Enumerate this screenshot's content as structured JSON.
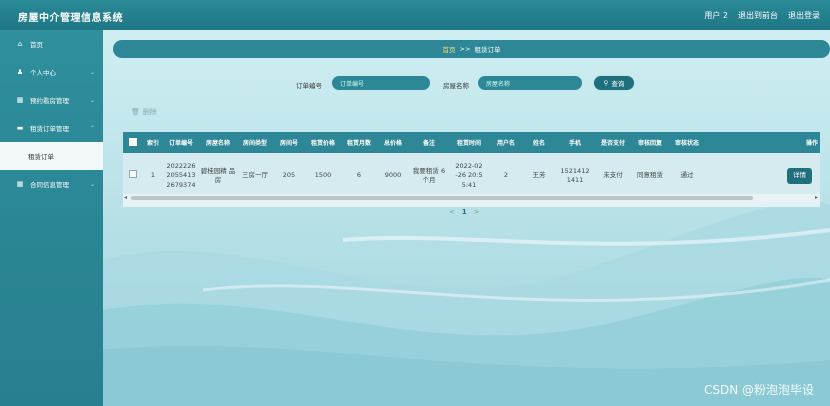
{
  "header": {
    "app_title": "房屋中介管理信息系统",
    "user": "用户 2",
    "back_to_front": "退出到前台",
    "logout": "退出登录"
  },
  "sidebar": {
    "items": [
      {
        "icon": "home-icon",
        "glyph": "⌂",
        "label": "首页",
        "has_chevron": false
      },
      {
        "icon": "user-icon",
        "glyph": "♟",
        "label": "个人中心",
        "has_chevron": true
      },
      {
        "icon": "grid-icon",
        "glyph": "▦",
        "label": "预约看房管理",
        "has_chevron": true
      },
      {
        "icon": "card-icon",
        "glyph": "▬",
        "label": "租赁订单管理",
        "has_chevron": true
      },
      {
        "icon": "",
        "glyph": "",
        "label": "租赁订单",
        "has_chevron": false,
        "active": true
      },
      {
        "icon": "grid-icon",
        "glyph": "▦",
        "label": "合同信息管理",
        "has_chevron": true
      }
    ]
  },
  "breadcrumb": {
    "home": "首页",
    "sep": ">>",
    "current": "租赁订单"
  },
  "search": {
    "order_label": "订单编号",
    "order_placeholder": "订单编号",
    "house_label": "房屋名称",
    "house_placeholder": "房屋名称",
    "search_btn": "查询"
  },
  "toolbar": {
    "delete_label": "删除"
  },
  "table": {
    "columns": [
      "索引",
      "订单编号",
      "房屋名称",
      "房间类型",
      "房间号",
      "租赁价格",
      "租赁月数",
      "总价格",
      "备注",
      "租赁时间",
      "用户名",
      "姓名",
      "手机",
      "是否支付",
      "审核回复",
      "审核状态",
      "操作"
    ],
    "rows": [
      {
        "index": "1",
        "order_no": "2022226 2055413 2679374",
        "house_name": "碧桂园精 品房",
        "room_type": "三房一厅",
        "room_no": "205",
        "price": "1500",
        "months": "6",
        "total": "9000",
        "remark": "我要租赁 6个月",
        "rent_time": "2022-02 -26 20:5 5:41",
        "username": "2",
        "name": "王芳",
        "phone": "1521412 1411",
        "paid": "未支付",
        "reply": "同意租赁",
        "status": "通过",
        "action": "详情"
      }
    ]
  },
  "pagination": {
    "prev": "<",
    "current": "1",
    "next": ">"
  },
  "watermark": "CSDN @粉泡泡毕设"
}
